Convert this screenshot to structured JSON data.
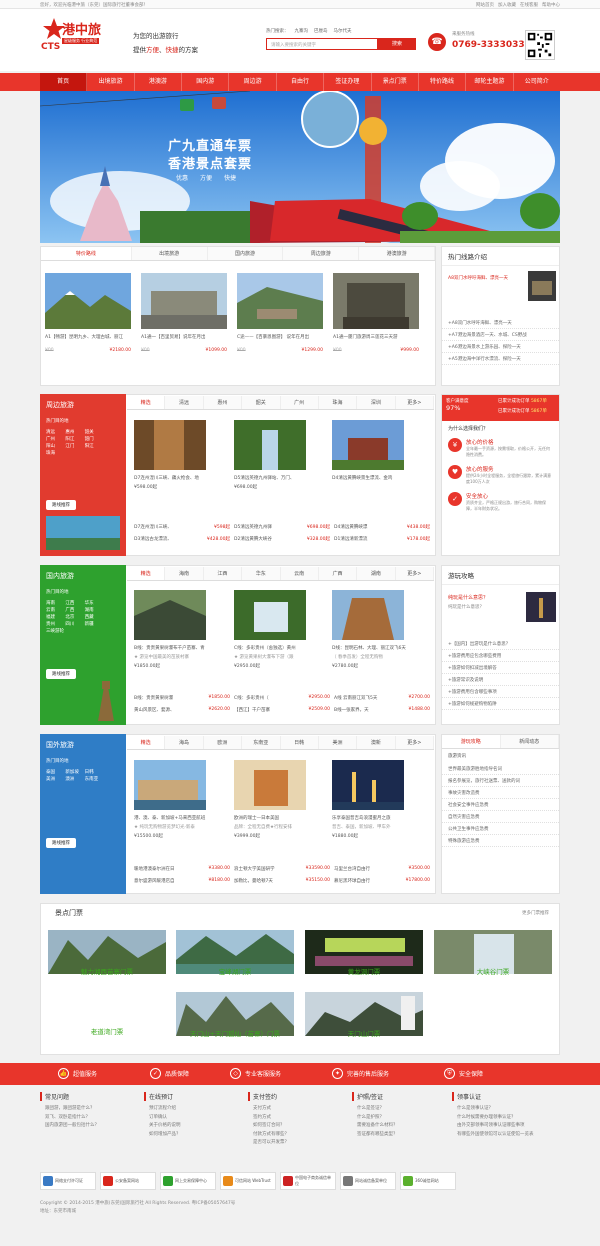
{
  "topbar": {
    "welcome": "您好，欢迎光临港中旅（东莞）国际旅行社董事会部！",
    "links": [
      "网站首页",
      "加入收藏",
      "在线客服",
      "帮助中心"
    ]
  },
  "header": {
    "logo_text": "港中旅",
    "logo_cts": "CTS",
    "logo_sub": "星级服务 行业典范",
    "slogan_line1": "为您的出游旅行",
    "slogan_line2_pre": "提供",
    "slogan_line2_em1": "方便",
    "slogan_line2_sep": "、",
    "slogan_line2_em2": "快捷",
    "slogan_line2_post": "的方案",
    "hot_label": "热门搜索：",
    "hot": [
      "九寨沟",
      "巴厘岛",
      "马尔代夫"
    ],
    "search_placeholder": "请输入要搜索的关键字",
    "search_btn": "搜索",
    "phone_label": "来服务热线",
    "phone": "0769-33330333"
  },
  "nav": [
    "首页",
    "出境旅游",
    "港澳游",
    "国内游",
    "周边游",
    "自由行",
    "签证办理",
    "景点门票",
    "特价路线",
    "邮轮主题游",
    "公司简介"
  ],
  "banner": {
    "title1": "广九直通车票",
    "title2": "香港景点套票",
    "tags": [
      "优惠",
      "方便",
      "快捷"
    ]
  },
  "special": {
    "tabs": [
      "特价路线",
      "出境旅游",
      "国内旅游",
      "周边旅游",
      "港澳旅游"
    ],
    "products": [
      {
        "title": "A1【畅游】昆明九乡、大理古城、丽江",
        "old": "¥00",
        "price": "¥2180.00"
      },
      {
        "title": "A1通一【百里贸易】说年在月出",
        "old": "¥00",
        "price": "¥1099.00"
      },
      {
        "title": "C途——【百暴恩图游】 说年在月出",
        "old": "¥00",
        "price": "¥1299.00"
      },
      {
        "title": "A1通一厦门旅游周三莲花三天游",
        "old": "¥00",
        "price": "¥999.00"
      }
    ]
  },
  "hot_routes": {
    "title": "热门线路介绍",
    "feature": "A8双门水呼吁海鲜、漂亮一天",
    "items": [
      "+A8双门水呼吁海鲜、漂亮一天",
      "+A7港边海景酒店一天、水城、CS野战",
      "+A6港边海景水上游乐园、探险一天",
      "+A5港边海中洋行水漂流、探险一天"
    ]
  },
  "zhoubian": {
    "title": "周边旅游",
    "city_label": "热门目的地",
    "cities": [
      "清远",
      "惠州",
      "韶关",
      "广州",
      "阳江",
      "韶门",
      "阳山",
      "江门",
      "阳江",
      "珠海"
    ],
    "btn": "路线推荐",
    "tabs": [
      "精选",
      "清远",
      "惠州",
      "韶关",
      "广州",
      "珠海",
      "深圳",
      "更多>"
    ],
    "products": [
      {
        "title": "D7连州湟川三峡、藕火枪会、地",
        "price": "¥598.00起"
      },
      {
        "title": "D5清远英德九州驿站、万门、",
        "price": "¥698.00起"
      },
      {
        "title": "D4清远黄腾峡景生漂流、金鸡",
        "price": ""
      }
    ],
    "rows": [
      [
        {
          "t": "D7连州湟川三峡、",
          "p": "¥598起"
        },
        {
          "t": "D5清远英德九州驿",
          "p": "¥698.00起"
        },
        {
          "t": "D4清远黄腾峡漂",
          "p": "¥438.00起"
        }
      ],
      [
        {
          "t": "D3清远古龙漂流、",
          "p": "¥428.00起"
        },
        {
          "t": "D2清远黄腾大峡谷",
          "p": "¥328.00起"
        },
        {
          "t": "D1清远清新漂流",
          "p": "¥178.00起"
        }
      ]
    ]
  },
  "stats": {
    "sat_label": "客户满意度",
    "sat_value": "97%",
    "sat_count_label": "已累计成功订单",
    "sat_count": "5867单",
    "count2_label": "已累计成功订单",
    "count2": "5867单"
  },
  "why": {
    "title": "为什么选择我们？",
    "items": [
      {
        "h": "放心的价格",
        "d": "全年最一手资源，按需领取，价格公开，无任何隐性消费。"
      },
      {
        "h": "放心的服务",
        "d": "提供24小时全程服务，全程旅行跟踪，累计满意度100万人次"
      },
      {
        "h": "安全放心",
        "d": "资质齐全，严格正规出游，旅行合同，购物保障，半年财务状况。"
      }
    ]
  },
  "guonei": {
    "title": "国内旅游",
    "city_label": "热门目的地",
    "cities": [
      "海南",
      "江西",
      "华东",
      "云南",
      "广西",
      "湖南",
      "福建",
      "北京",
      "西藏",
      "贵州",
      "四川",
      "新疆",
      "三峡游轮"
    ],
    "btn": "路线推荐",
    "tabs": [
      "精选",
      "海南",
      "江西",
      "华东",
      "云南",
      "广西",
      "湖南",
      "更多>"
    ],
    "products": [
      {
        "title": "B线：贵贵黄果树瀑布千户苗寨、青",
        "sub": "★ 游览中国最美的苗族村寨",
        "price": "¥1850.00起"
      },
      {
        "title": "C线：多彩贵州（舍独选）黄州",
        "sub": "★ 游览黄果树大瀑布下游（跟",
        "price": "¥2950.00起"
      },
      {
        "title": "D线：昆明石林、大理、丽江双飞6天",
        "sub": "（ 春季首发）全程无购物",
        "price": "¥2780.00起"
      }
    ],
    "rows": [
      [
        {
          "t": "B线：贵贵黄果树瀑",
          "p": "¥1850.00"
        },
        {
          "t": "C线：多彩贵州（",
          "p": "¥2950.00"
        },
        {
          "t": "A线 云南丽江双飞5天",
          "p": "¥2700.00"
        }
      ],
      [
        {
          "t": "黄山风景区、婺源、",
          "p": "¥2620.00"
        },
        {
          "t": "【西江】千户苗寨",
          "p": "¥2509.00"
        },
        {
          "t": "B线一张家界，天",
          "p": "¥1488.00"
        }
      ]
    ]
  },
  "strategy": {
    "title": "游玩攻略",
    "feature_title": "纯玩是什么意思？",
    "feature_desc": "纯玩是什么意思？",
    "items": [
      "+【国内】出游玩是什么意思？",
      "+旅游费用应包含哪些费用",
      "+旅游如何扣减出境解答",
      "+旅游常识及说明",
      "+旅游费用包含哪些事项",
      "+旅游如何规避购物陷阱"
    ]
  },
  "guowai": {
    "title": "国外旅游",
    "city_label": "热门目的地",
    "cities": [
      "泰国",
      "新加坡",
      "日韩",
      "美洲",
      "澳洲",
      "东南亚"
    ],
    "btn": "路线推荐",
    "tabs": [
      "精选",
      "海岛",
      "欧洲",
      "东南亚",
      "日韩",
      "美洲",
      "澳新",
      "更多>"
    ],
    "products": [
      {
        "title": "港、澳、泰、新加坡+马来西亚航班",
        "sub": "★ 纯玩无购物游览梦幻光·新泰",
        "price": "¥15500.00起"
      },
      {
        "title": "欧洲的瑞士—日本美国",
        "sub": "品牌：全程无自费★行程安排",
        "price": "¥3999.00起"
      },
      {
        "title": "乐享泰国普吉岛浪漫蜜月之旅",
        "sub": "普吉、泰国，新加坡、甲车外",
        "price": "¥1880.00起"
      }
    ],
    "rows": [
      [
        {
          "t": "暖地港澳泰尔洲在日",
          "p": "¥3380.00"
        },
        {
          "t": "浪士顿大学美国研学",
          "p": "¥33590.00"
        },
        {
          "t": "马里兰台湾自由行",
          "p": "¥3500.00"
        }
      ],
      [
        {
          "t": "意尔盛游风暖港店自",
          "p": "¥8180.00"
        },
        {
          "t": "加勒比，曼哈顿7天",
          "p": "¥35150.00"
        },
        {
          "t": "慕尼黑环球自由行",
          "p": "¥17800.00"
        }
      ]
    ]
  },
  "news": {
    "tabs": [
      "游玩攻略",
      "新闻动态"
    ],
    "head": "旅游资讯",
    "items": [
      "世界最美旅游胜地指导名词",
      "报名参展览，旅行社送票、送款的词",
      "事故灾害改造费",
      "社会安全事件应急费",
      "自然灾害应急费",
      "公共卫生事件应急费",
      "特殊旅游应急费"
    ]
  },
  "tickets": {
    "title": "景点门票",
    "more": "更多门票推荐",
    "items": [
      "魅力湘西苗寨门票",
      "宝峰湖门票",
      "黄龙洞门票",
      "大峡谷门票",
      "老道湾门票",
      "天门山+天门狐仙（苗寨）门票",
      "天门山门票"
    ]
  },
  "services": [
    "超值服务",
    "品质保障",
    "专业客服服务",
    "完善的售后服务",
    "安全保障"
  ],
  "footer": {
    "cols": [
      {
        "h": "常见问题",
        "items": [
          "跟团游，跟团游是什么？",
          "双飞、双卧是指什么？",
          "国内旅游团一般包括什么？"
        ]
      },
      {
        "h": "在线预订",
        "items": [
          "预订流程介绍",
          "订单确认",
          "关于价格的说明",
          "如何增加产品？"
        ]
      },
      {
        "h": "支付签约",
        "items": [
          "支付方式",
          "签约方式",
          "如何签订合同？",
          "付款方式有哪些？",
          "是否可以开发票？"
        ]
      },
      {
        "h": "护照/签证",
        "items": [
          "什么是签证？",
          "什么是护照？",
          "需要准备什么材料？",
          "签证都有哪些类型？"
        ]
      },
      {
        "h": "领事认证",
        "items": [
          "什么是领事认证？",
          "什么时候需要办理领事认证？",
          "由外交部领事司领事认证哪些事项",
          "有哪些外国使领馆可以认证使馆一览表"
        ]
      }
    ],
    "badges": [
      "网络支付许可证",
      "公安备案网站",
      "网上交易保障中心",
      "可信网站 WebTrust",
      "中国电子商务诚信单位",
      "网站诚信备案单位",
      "360诚信网站"
    ],
    "copyright": "Copyright © 2014-2015 港中旅(东莞)国际旅行社 All Rights Reserved. 粤ICP备05057647号",
    "address": "地址：东莞市南城"
  },
  "colors": {
    "accent": "#e8352b",
    "green": "#2ea12e",
    "blue": "#2f7dc6",
    "price": "#d9261c"
  }
}
